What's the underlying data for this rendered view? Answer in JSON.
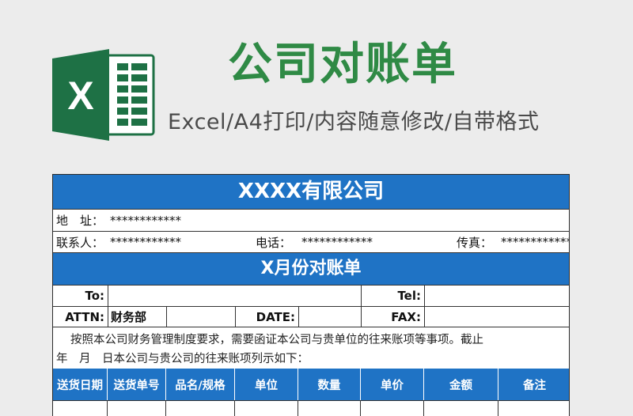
{
  "header": {
    "title": "公司对账单",
    "subtitle": "Excel/A4打印/内容随意修改/自带格式",
    "logo_letter": "X",
    "logo_green": "#1e7145",
    "title_color": "#2f8a45"
  },
  "sheet": {
    "company": "XXXX有限公司",
    "address_label": "地　址：",
    "address_value": "************",
    "contact_label": "联系人：",
    "contact_value": "************",
    "phone_label": "电话：",
    "phone_value": "************",
    "fax_label": "传真：",
    "fax_value": "************",
    "month_title": "X月份对账单",
    "to_label": "To:",
    "tel_label": "Tel:",
    "attn_label": "ATTN:",
    "attn_value": "财务部",
    "date_label": "DATE:",
    "fax2_label": "FAX:",
    "intro_line1": "按照本公司财务管理制度要求，需要函证本公司与贵单位的往来账项等事项。截止",
    "intro_line2": "年　月　日本公司与贵公司的往来账项列示如下：",
    "columns": [
      "送货日期",
      "送货单号",
      "品名/规格",
      "单位",
      "数量",
      "单价",
      "金额",
      "备注"
    ],
    "accent_color": "#1f73c5"
  }
}
